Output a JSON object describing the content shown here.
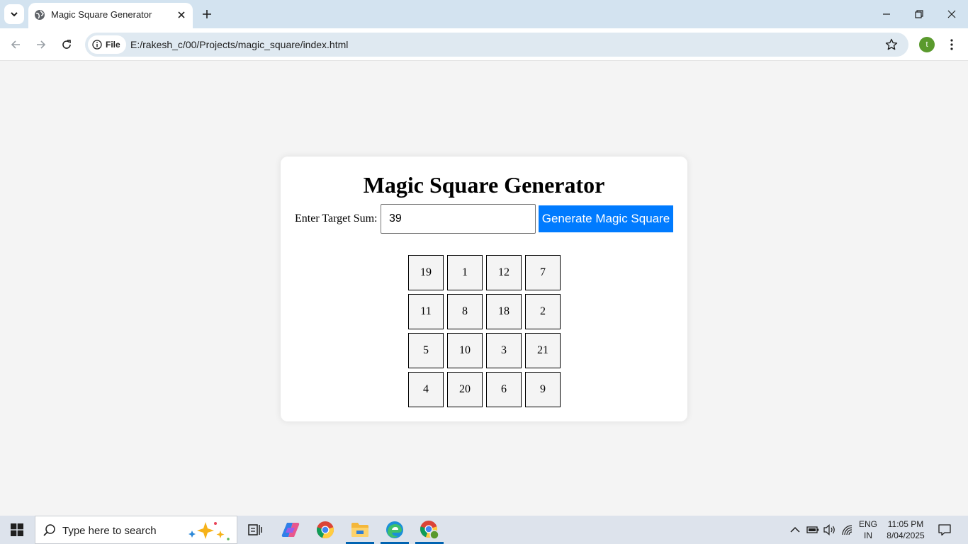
{
  "browser": {
    "tab_title": "Magic Square Generator",
    "address_chip": "File",
    "url": "E:/rakesh_c/00/Projects/magic_square/index.html",
    "profile_initial": "t",
    "icons": {
      "tab_search": "chevron-down-icon",
      "favicon": "globe-icon",
      "tab_close": "close-icon",
      "new_tab": "plus-icon",
      "minimize": "minimize-icon",
      "restore": "restore-icon",
      "close_window": "close-icon",
      "back": "back-arrow-icon",
      "forward": "forward-arrow-icon",
      "reload": "reload-icon",
      "info": "info-icon",
      "bookmark": "star-icon",
      "menu": "kebab-menu-icon"
    }
  },
  "page": {
    "heading": "Magic Square Generator",
    "target_label": "Enter Target Sum:",
    "target_value": "39",
    "generate_label": "Generate Magic Square",
    "accent_color": "#007bff",
    "grid": [
      [
        "19",
        "1",
        "12",
        "7"
      ],
      [
        "11",
        "8",
        "18",
        "2"
      ],
      [
        "5",
        "10",
        "3",
        "21"
      ],
      [
        "4",
        "20",
        "6",
        "9"
      ]
    ]
  },
  "taskbar": {
    "search_placeholder": "Type here to search",
    "apps": [
      "task-view",
      "copilot",
      "chrome",
      "file-explorer",
      "edge",
      "chrome-profile"
    ],
    "language_top": "ENG",
    "language_bottom": "IN",
    "time": "11:05 PM",
    "date": "8/04/2025"
  }
}
